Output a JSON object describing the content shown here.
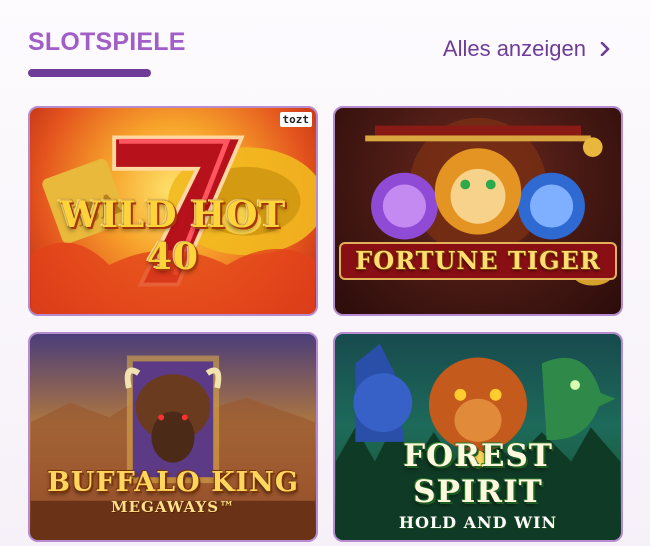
{
  "section": {
    "title": "SLOTSPIELE",
    "show_all": "Alles anzeigen"
  },
  "games": [
    {
      "name": "WILD HOT 40",
      "provider_badge": "tozt"
    },
    {
      "name": "FORTUNE TIGER"
    },
    {
      "name": "BUFFALO KING",
      "subtitle": "MEGAWAYS™"
    },
    {
      "name": "FOREST SPIRIT",
      "subtitle": "HOLD AND WIN"
    }
  ],
  "colors": {
    "title": "#a05ec6",
    "accent": "#6e3c97",
    "tile_border": "#b68bd0"
  }
}
